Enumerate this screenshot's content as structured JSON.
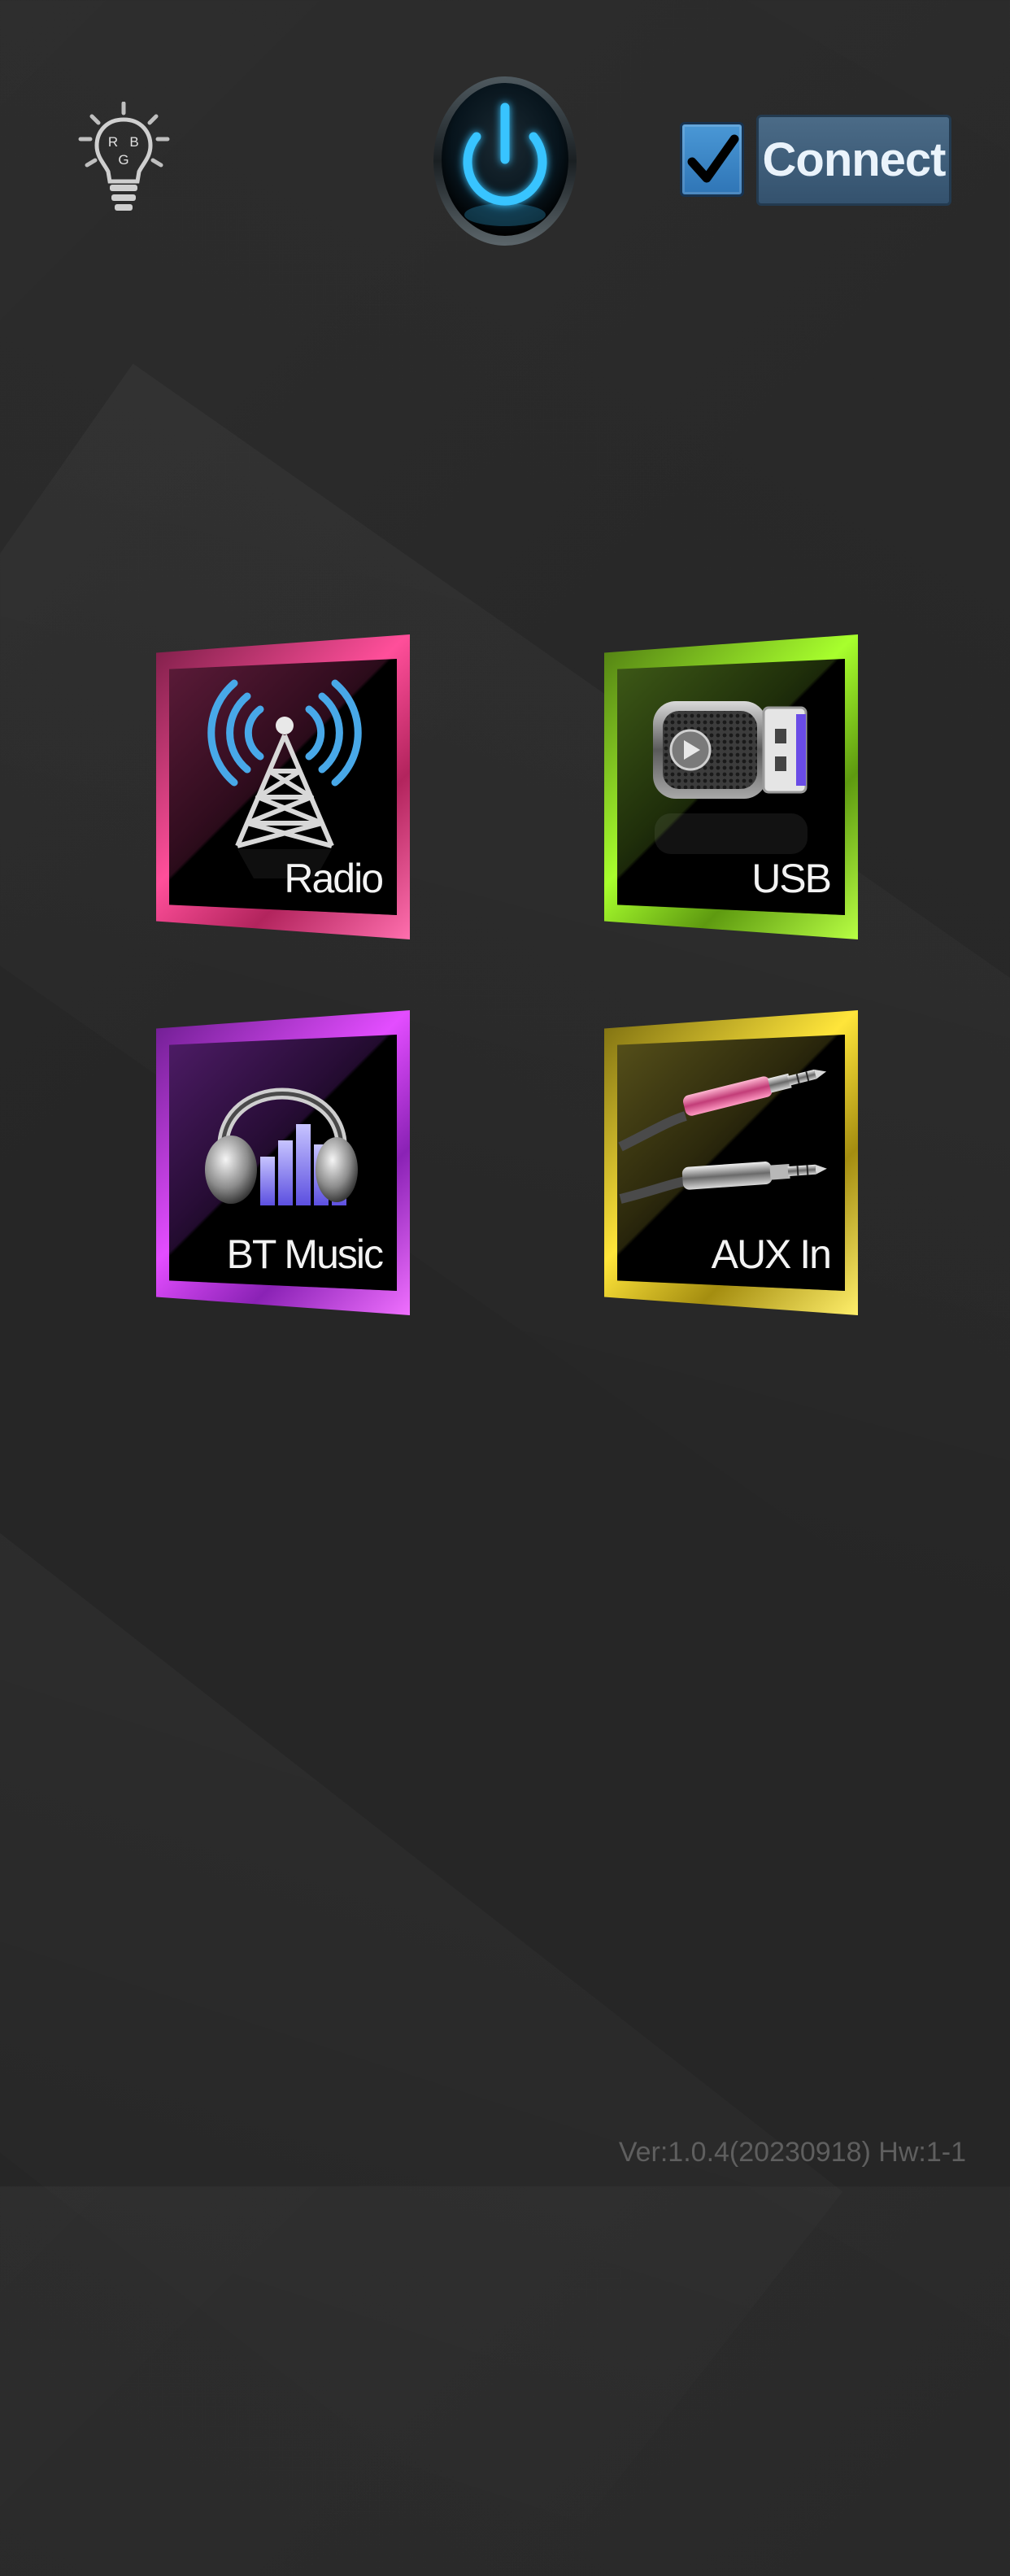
{
  "colors": {
    "background": "#262626",
    "power_glow": "#37c4ff",
    "connect_bg": "#3f5f7c",
    "checkbox_bg": "#3c86c8",
    "radio_accent": "#ff4f9a",
    "usb_accent": "#a8ff2d",
    "bt_accent": "#e34dff",
    "aux_accent": "#ffe53a",
    "version_text": "#5f5f5f"
  },
  "top_bar": {
    "rgb_icon": "rgb-light-bulb-icon",
    "rgb_letters": [
      "R",
      "B",
      "G"
    ],
    "power_icon": "power-icon",
    "connect_checked": true,
    "connect_label": "Connect"
  },
  "modes": [
    {
      "label": "Radio",
      "icon": "radio-tower-icon"
    },
    {
      "label": "USB",
      "icon": "usb-drive-icon"
    },
    {
      "label": "BT Music",
      "icon": "headphones-icon"
    },
    {
      "label": "AUX In",
      "icon": "aux-cable-icon"
    }
  ],
  "footer": {
    "version_text": "Ver:1.0.4(20230918) Hw:1-1"
  }
}
